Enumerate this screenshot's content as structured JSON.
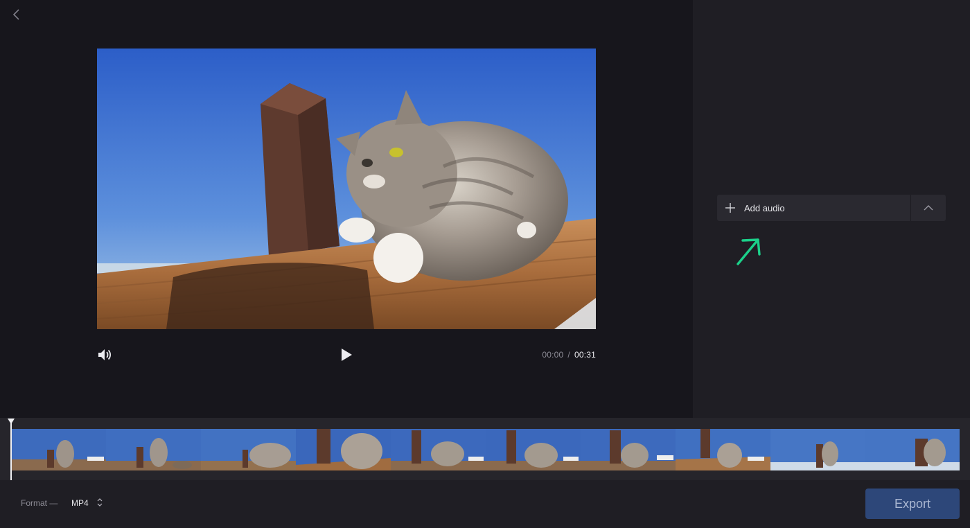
{
  "app": {
    "back_icon": "chevron-left-icon"
  },
  "player": {
    "current_time": "00:00",
    "separator": "/",
    "duration": "00:31",
    "volume_icon": "volume-icon",
    "play_icon": "play-icon",
    "preview_description_icon": "video-preview"
  },
  "audio_panel": {
    "add_label": "Add audio",
    "add_icon": "plus-icon",
    "collapse_icon": "chevron-up-icon",
    "hint_icon": "arrow-up-right-icon",
    "hint_color": "#1bd18a"
  },
  "timeline": {
    "frame_count": 10,
    "playhead_position": 0
  },
  "footer": {
    "format_label": "Format —",
    "format_value": "MP4",
    "format_icon": "up-down-arrows-icon",
    "export_label": "Export",
    "export_color": "#2d4779"
  },
  "colors": {
    "background": "#17161c",
    "panel": "#1f1e24",
    "accent_green": "#1bd18a"
  }
}
